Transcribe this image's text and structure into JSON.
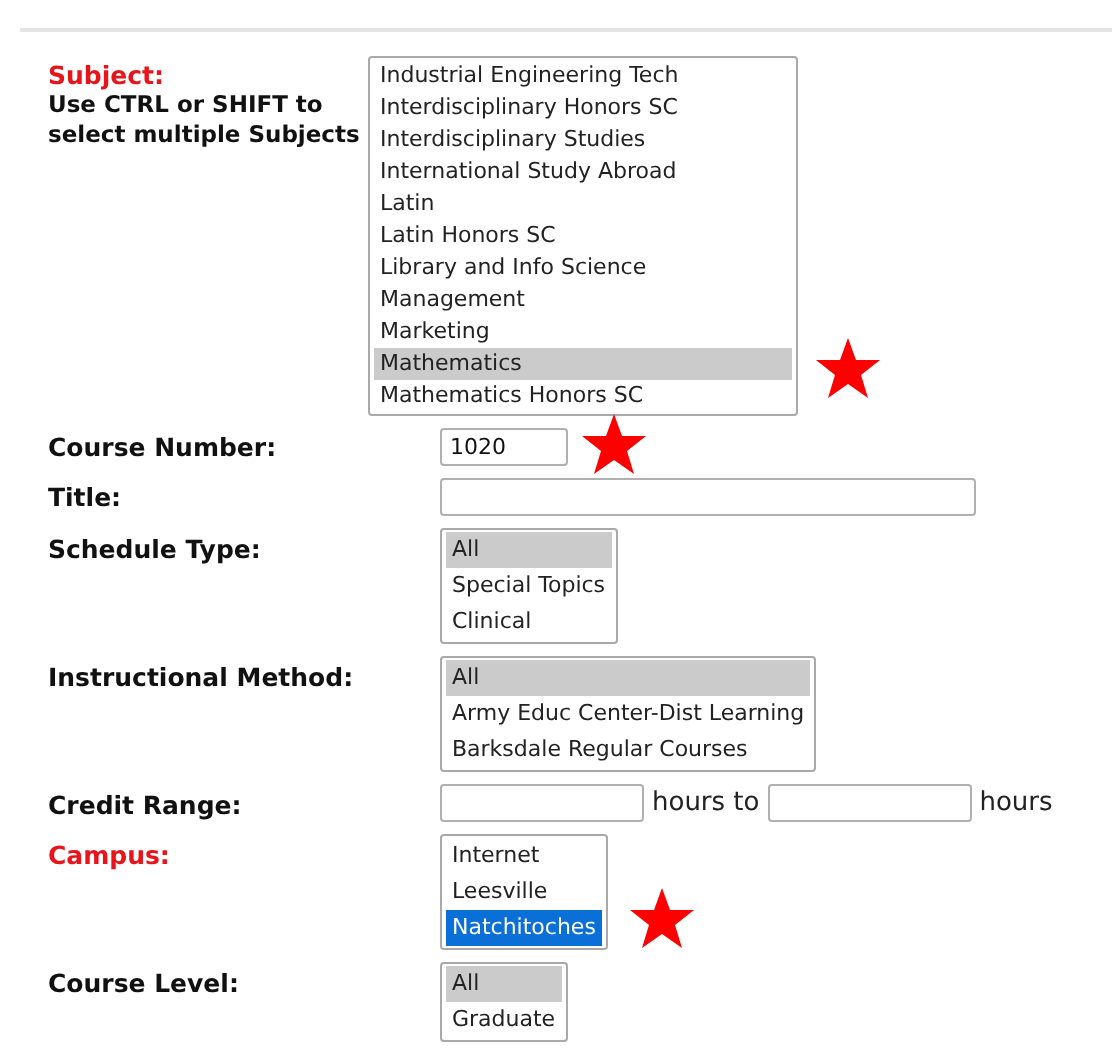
{
  "fields": [
    {
      "kind": "listbox",
      "label": "Subject:",
      "required": true,
      "hint": "Use CTRL or SHIFT to select multiple Subjects",
      "focused": false,
      "starred": true,
      "options": [
        {
          "text": "Industrial Engineering Tech",
          "selected": false
        },
        {
          "text": "Interdisciplinary Honors SC",
          "selected": false
        },
        {
          "text": "Interdisciplinary Studies",
          "selected": false
        },
        {
          "text": "International Study Abroad",
          "selected": false
        },
        {
          "text": "Latin",
          "selected": false
        },
        {
          "text": "Latin Honors SC",
          "selected": false
        },
        {
          "text": "Library and Info Science",
          "selected": false
        },
        {
          "text": "Management",
          "selected": false
        },
        {
          "text": "Marketing",
          "selected": false
        },
        {
          "text": "Mathematics",
          "selected": true
        },
        {
          "text": "Mathematics Honors SC",
          "selected": false
        }
      ]
    },
    {
      "kind": "short_text",
      "label": "Course Number:",
      "required": false,
      "value": "1020",
      "starred": true
    },
    {
      "kind": "long_text",
      "label": "Title:",
      "required": false,
      "starred": false
    },
    {
      "kind": "listbox",
      "label": "Schedule Type:",
      "required": false,
      "focused": false,
      "starred": false,
      "options": [
        {
          "text": "All",
          "selected": true
        },
        {
          "text": "Special Topics",
          "selected": false
        },
        {
          "text": "Clinical",
          "selected": false
        }
      ]
    },
    {
      "kind": "listbox",
      "label": "Instructional Method:",
      "required": false,
      "focused": false,
      "starred": false,
      "options": [
        {
          "text": "All",
          "selected": true
        },
        {
          "text": "Army Educ Center-Dist Learning",
          "selected": false
        },
        {
          "text": "Barksdale Regular Courses",
          "selected": false
        }
      ]
    },
    {
      "kind": "range",
      "label": "Credit Range:",
      "required": false,
      "separator": "hours to",
      "unit": "hours",
      "starred": false
    },
    {
      "kind": "listbox",
      "label": "Campus:",
      "required": true,
      "focused": true,
      "starred": true,
      "options": [
        {
          "text": "Internet",
          "selected": false
        },
        {
          "text": "Leesville",
          "selected": false
        },
        {
          "text": "Natchitoches",
          "selected": true
        }
      ]
    },
    {
      "kind": "listbox",
      "label": "Course Level:",
      "required": false,
      "focused": false,
      "starred": false,
      "options": [
        {
          "text": "All",
          "selected": true
        },
        {
          "text": "Graduate",
          "selected": false
        }
      ]
    }
  ]
}
